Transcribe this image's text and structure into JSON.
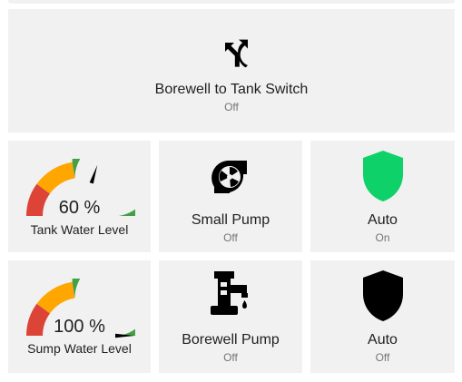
{
  "dashboard": {
    "switch_card": {
      "name": "Borewell to Tank Switch",
      "state": "Off",
      "icon": "source-branch-icon"
    },
    "tank_gauge": {
      "value": 60,
      "unit": "%",
      "value_text": "60 %",
      "name": "Tank Water Level",
      "min": 0,
      "max": 100,
      "segments": [
        {
          "from": 0,
          "to": 20,
          "color": "#db4437"
        },
        {
          "from": 20,
          "to": 45,
          "color": "#ffa600"
        },
        {
          "from": 45,
          "to": 100,
          "color": "#43a047"
        }
      ]
    },
    "small_pump": {
      "name": "Small Pump",
      "state": "Off",
      "icon": "pump-icon"
    },
    "auto_1": {
      "name": "Auto",
      "state": "On",
      "icon": "shield-icon",
      "color": "#0ed16a"
    },
    "sump_gauge": {
      "value": 100,
      "unit": "%",
      "value_text": "100 %",
      "name": "Sump Water Level",
      "min": 0,
      "max": 100,
      "segments": [
        {
          "from": 0,
          "to": 20,
          "color": "#db4437"
        },
        {
          "from": 20,
          "to": 45,
          "color": "#ffa600"
        },
        {
          "from": 45,
          "to": 100,
          "color": "#43a047"
        }
      ]
    },
    "borewell_pump": {
      "name": "Borewell Pump",
      "state": "Off",
      "icon": "water-pump-tap-icon"
    },
    "auto_2": {
      "name": "Auto",
      "state": "Off",
      "icon": "shield-icon",
      "color": "#000000"
    }
  }
}
